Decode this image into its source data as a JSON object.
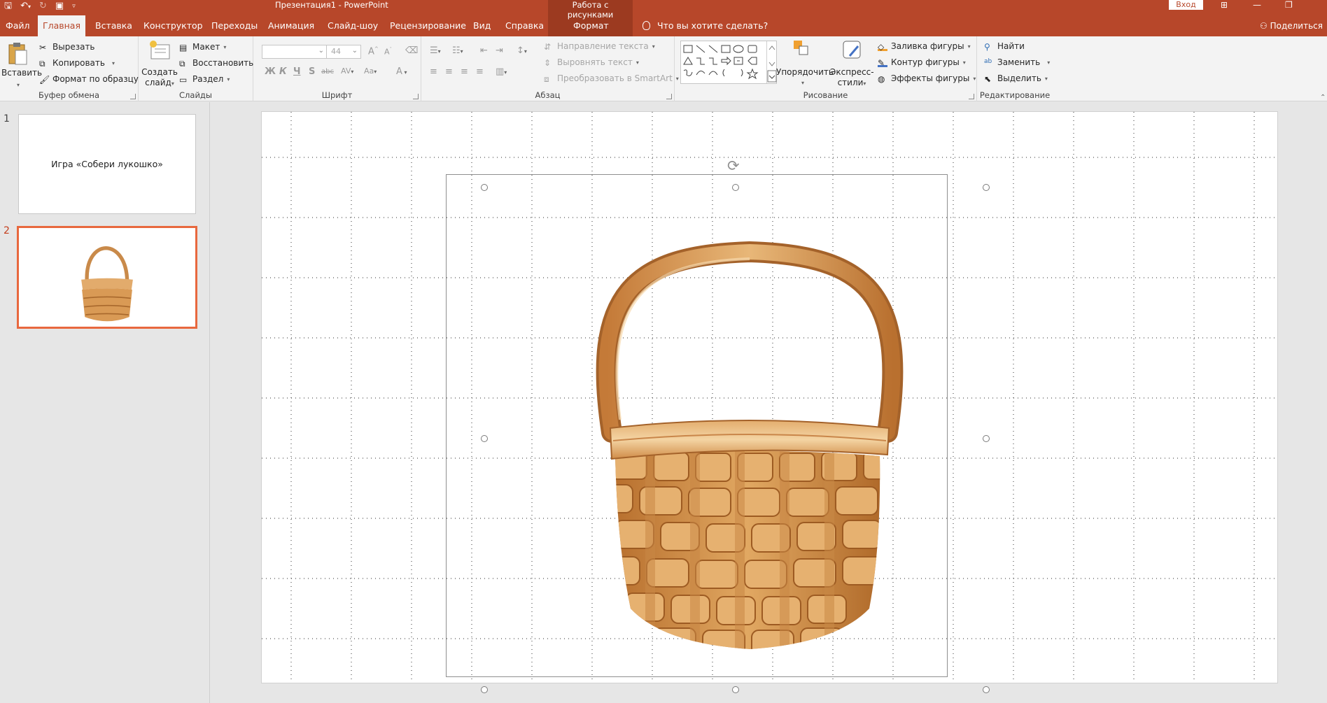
{
  "qat": {
    "save_icon": "save-icon",
    "undo_icon": "undo-icon",
    "redo_icon": "redo-icon",
    "present_icon": "start-from-beginning-icon",
    "customize_icon": "customize-qat-icon"
  },
  "window": {
    "title": "Презентация1  -  PowerPoint",
    "context_group": "Работа с рисунками",
    "signin": "Вход",
    "ribbon_options_icon": "ribbon-display-options-icon",
    "minimize_icon": "minimize-icon",
    "restore_icon": "restore-icon"
  },
  "tabs": [
    {
      "label": "Файл"
    },
    {
      "label": "Главная",
      "active": true
    },
    {
      "label": "Вставка"
    },
    {
      "label": "Конструктор"
    },
    {
      "label": "Переходы"
    },
    {
      "label": "Анимация"
    },
    {
      "label": "Слайд-шоу"
    },
    {
      "label": "Рецензирование"
    },
    {
      "label": "Вид"
    },
    {
      "label": "Справка"
    },
    {
      "label": "Формат"
    }
  ],
  "tellme": "Что вы хотите сделать?",
  "share": "Поделиться",
  "ribbon": {
    "clipboard": {
      "label": "Буфер обмена",
      "paste": "Вставить",
      "cut": "Вырезать",
      "copy": "Копировать",
      "format_painter": "Формат по образцу"
    },
    "slides": {
      "label": "Слайды",
      "new_slide_1": "Создать",
      "new_slide_2": "слайд",
      "layout": "Макет",
      "reset": "Восстановить",
      "section": "Раздел"
    },
    "font": {
      "label": "Шрифт",
      "font_name": "",
      "font_size": "44",
      "bold": "Ж",
      "italic": "К",
      "underline": "Ч",
      "shadow": "S",
      "strike": "abc",
      "spacing": "AV",
      "case": "Аа",
      "color": "A"
    },
    "paragraph": {
      "label": "Абзац",
      "text_direction": "Направление текста",
      "align_text": "Выровнять текст",
      "smartart": "Преобразовать в SmartArt"
    },
    "drawing": {
      "label": "Рисование",
      "arrange": "Упорядочить",
      "quick_styles_1": "Экспресс-",
      "quick_styles_2": "стили",
      "fill": "Заливка фигуры",
      "outline": "Контур фигуры",
      "effects": "Эффекты фигуры"
    },
    "editing": {
      "label": "Редактирование",
      "find": "Найти",
      "replace": "Заменить",
      "select": "Выделить"
    }
  },
  "slides": [
    {
      "number": "1",
      "title": "Игра «Собери лукошко»"
    },
    {
      "number": "2",
      "title": "",
      "selected": true,
      "image": "basket-illustration"
    }
  ],
  "canvas": {
    "image": "wicker-basket",
    "accent": "#b7472a",
    "selection_color": "#e8683e"
  }
}
